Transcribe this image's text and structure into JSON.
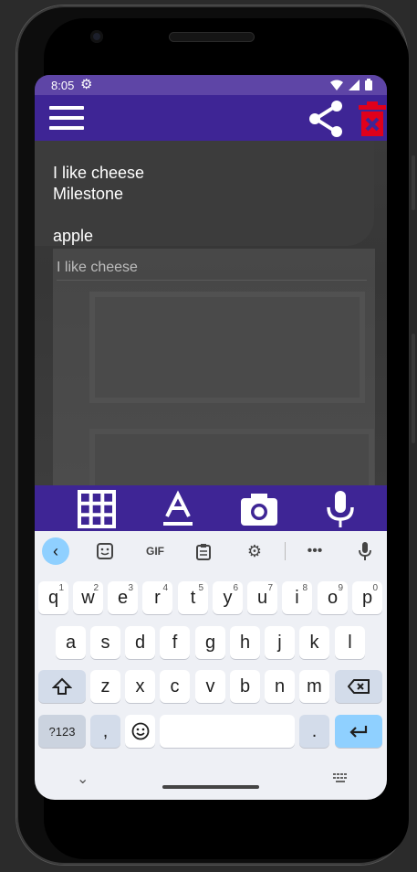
{
  "status_bar": {
    "time": "8:05"
  },
  "app_bar": {
    "menu_icon": "menu-icon",
    "share_icon": "share-icon",
    "delete_icon": "trash-icon"
  },
  "note": {
    "lines": [
      "I like cheese",
      "Milestone"
    ],
    "title": "apple",
    "input_text": "I like cheese"
  },
  "toolbar": [
    "grid-icon",
    "text-format-icon",
    "camera-icon",
    "microphone-icon"
  ],
  "keyboard": {
    "suggestions": [
      "back-chevron-icon",
      "sticker-icon",
      "GIF",
      "clipboard-icon",
      "settings-icon",
      "more-icon",
      "mic-icon"
    ],
    "row1": [
      {
        "k": "q",
        "s": "1"
      },
      {
        "k": "w",
        "s": "2"
      },
      {
        "k": "e",
        "s": "3"
      },
      {
        "k": "r",
        "s": "4"
      },
      {
        "k": "t",
        "s": "5"
      },
      {
        "k": "y",
        "s": "6"
      },
      {
        "k": "u",
        "s": "7"
      },
      {
        "k": "i",
        "s": "8"
      },
      {
        "k": "o",
        "s": "9"
      },
      {
        "k": "p",
        "s": "0"
      }
    ],
    "row2": [
      "a",
      "s",
      "d",
      "f",
      "g",
      "h",
      "j",
      "k",
      "l"
    ],
    "row3": [
      "z",
      "x",
      "c",
      "v",
      "b",
      "n",
      "m"
    ],
    "symbols_key": "?123",
    "comma_key": ",",
    "period_key": "."
  },
  "colors": {
    "status_bar": "#5e45a6",
    "app_bar": "#3e2595",
    "delete": "#e0001b",
    "keyboard_bg": "#eef0f5"
  }
}
